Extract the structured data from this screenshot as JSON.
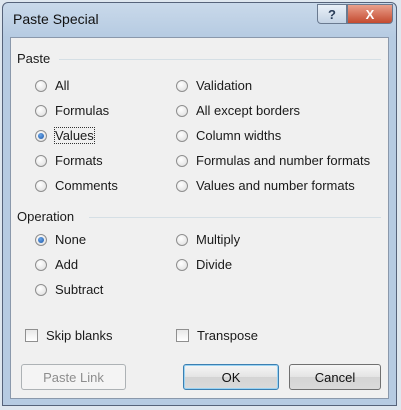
{
  "window": {
    "title": "Paste Special",
    "help_icon": "?",
    "close_icon": "X"
  },
  "paste_group": {
    "label": "Paste",
    "options": [
      {
        "label": "All",
        "checked": false
      },
      {
        "label": "Formulas",
        "checked": false
      },
      {
        "label": "Values",
        "checked": true
      },
      {
        "label": "Formats",
        "checked": false
      },
      {
        "label": "Comments",
        "checked": false
      },
      {
        "label": "Validation",
        "checked": false
      },
      {
        "label": "All except borders",
        "checked": false
      },
      {
        "label": "Column widths",
        "checked": false
      },
      {
        "label": "Formulas and number formats",
        "checked": false
      },
      {
        "label": "Values and number formats",
        "checked": false
      }
    ]
  },
  "operation_group": {
    "label": "Operation",
    "options": [
      {
        "label": "None",
        "checked": true
      },
      {
        "label": "Add",
        "checked": false
      },
      {
        "label": "Subtract",
        "checked": false
      },
      {
        "label": "Multiply",
        "checked": false
      },
      {
        "label": "Divide",
        "checked": false
      }
    ]
  },
  "checkboxes": {
    "skip_blanks": {
      "label": "Skip blanks",
      "checked": false
    },
    "transpose": {
      "label": "Transpose",
      "checked": false
    }
  },
  "buttons": {
    "paste_link": "Paste Link",
    "ok": "OK",
    "cancel": "Cancel"
  }
}
